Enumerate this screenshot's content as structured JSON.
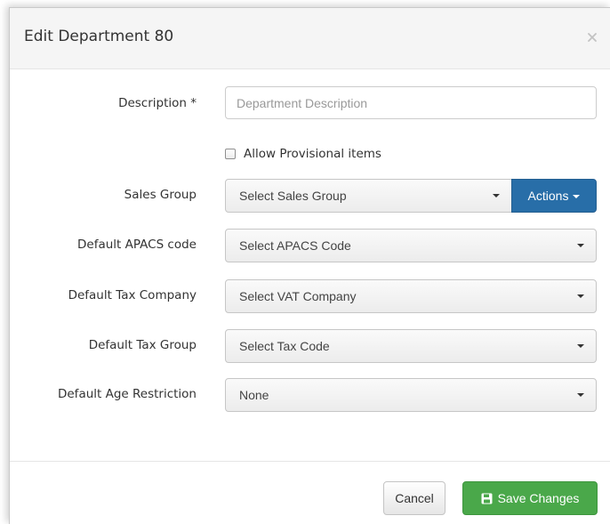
{
  "modal": {
    "title": "Edit Department 80",
    "close_icon": "close-icon"
  },
  "form": {
    "description": {
      "label": "Description *",
      "value": "",
      "placeholder": "Department Description"
    },
    "allow_provisional": {
      "label": "Allow Provisional items",
      "checked": false
    },
    "sales_group": {
      "label": "Sales Group",
      "selected": "Select Sales Group",
      "actions_label": "Actions"
    },
    "apacs_code": {
      "label": "Default APACS code",
      "selected": "Select APACS Code"
    },
    "tax_company": {
      "label": "Default Tax Company",
      "selected": "Select VAT Company"
    },
    "tax_group": {
      "label": "Default Tax Group",
      "selected": "Select Tax Code"
    },
    "age_restriction": {
      "label": "Default Age Restriction",
      "selected": "None"
    }
  },
  "footer": {
    "cancel_label": "Cancel",
    "save_label": "Save Changes",
    "save_icon": "floppy-disk-icon"
  },
  "colors": {
    "primary": "#286ea8",
    "success": "#4aa84a",
    "header_bg": "#f5f5f5"
  }
}
